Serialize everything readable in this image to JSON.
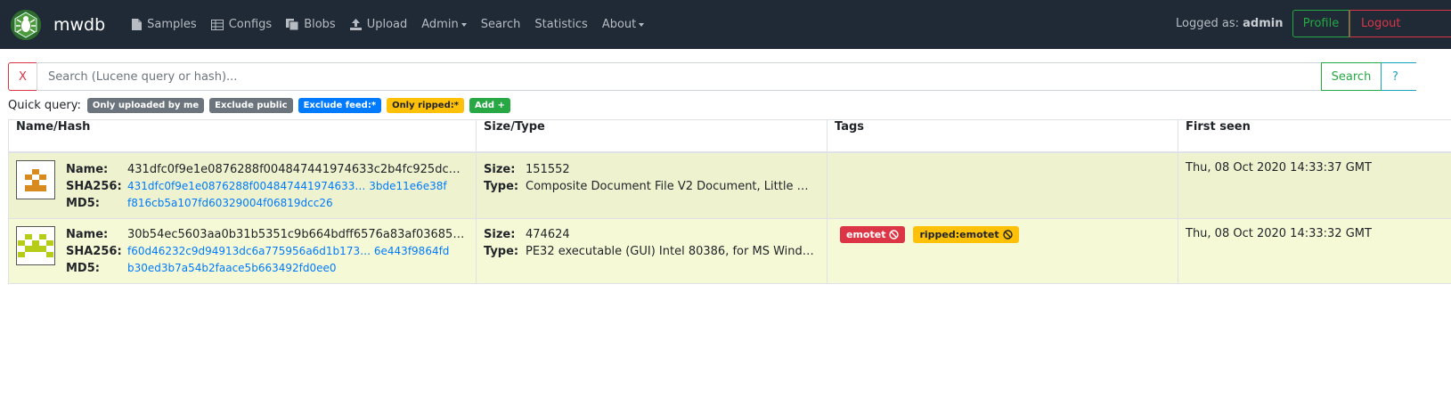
{
  "navbar": {
    "brand": "mwdb",
    "items": [
      {
        "label": "Samples",
        "icon": "file-icon"
      },
      {
        "label": "Configs",
        "icon": "table-icon"
      },
      {
        "label": "Blobs",
        "icon": "copy-icon"
      },
      {
        "label": "Upload",
        "icon": "upload-icon"
      },
      {
        "label": "Admin",
        "dropdown": true
      },
      {
        "label": "Search"
      },
      {
        "label": "Statistics"
      },
      {
        "label": "About",
        "dropdown": true
      }
    ],
    "logged_prefix": "Logged as:",
    "logged_user": "admin",
    "profile_label": "Profile",
    "logout_label": "Logout"
  },
  "search": {
    "clear_label": "X",
    "placeholder": "Search (Lucene query or hash)...",
    "value": "",
    "submit_label": "Search",
    "help_label": "?"
  },
  "quick_query": {
    "label": "Quick query:",
    "badges": [
      "Only uploaded by me",
      "Exclude public",
      "Exclude feed:*",
      "Only ripped:*",
      "Add +"
    ]
  },
  "table": {
    "columns": [
      "Name/Hash",
      "Size/Type",
      "Tags",
      "First seen"
    ],
    "field_labels": {
      "name": "Name:",
      "sha256": "SHA256:",
      "md5": "MD5:",
      "size": "Size:",
      "type": "Type:"
    },
    "rows": [
      {
        "name": "431dfc0f9e1e0876288f004847441974633c2b4fc925dc…",
        "sha256": "431dfc0f9e1e0876288f004847441974633… 3bde11e6e38f",
        "md5": "f816cb5a107fd60329004f06819dcc26",
        "size": "151552",
        "type": "Composite Document File V2 Document, Little …",
        "tags": [],
        "first_seen": "Thu, 08 Oct 2020 14:33:37 GMT",
        "identicon_color": "#d98a1f"
      },
      {
        "name": "30b54ec5603aa0b31b5351c9b664bdff6576a83af03685…",
        "sha256": "f60d46232c9d94913dc6a775956a6d1b173… 6e443f9864fd",
        "md5": "b30ed3b7a54b2faace5b663492fd0ee0",
        "size": "474624",
        "type": "PE32 executable (GUI) Intel 80386, for MS Wind…",
        "tags": [
          "emotet",
          "ripped:emotet"
        ],
        "first_seen": "Thu, 08 Oct 2020 14:33:32 GMT",
        "identicon_color": "#b5cc18"
      }
    ]
  },
  "colors": {
    "navbar_bg": "#1f2a36",
    "row1_bg": "#eef2cf",
    "row2_bg": "#f6f9d6",
    "link": "#007bff",
    "danger": "#dc3545",
    "success": "#28a745",
    "warning": "#ffc107"
  }
}
